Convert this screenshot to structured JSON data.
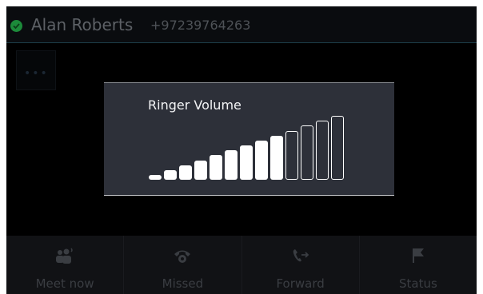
{
  "header": {
    "caller_name": "Alan Roberts",
    "caller_number": "+97239764263",
    "status_color": "#1c8a3a"
  },
  "dialog": {
    "title": "Ringer Volume",
    "volume": {
      "level": 9,
      "max": 13
    }
  },
  "softkeys": [
    {
      "label": "Meet now",
      "icon": "meet-now-icon"
    },
    {
      "label": "Missed",
      "icon": "missed-calls-icon"
    },
    {
      "label": "Forward",
      "icon": "forward-icon"
    },
    {
      "label": "Status",
      "icon": "status-flag-icon"
    }
  ]
}
